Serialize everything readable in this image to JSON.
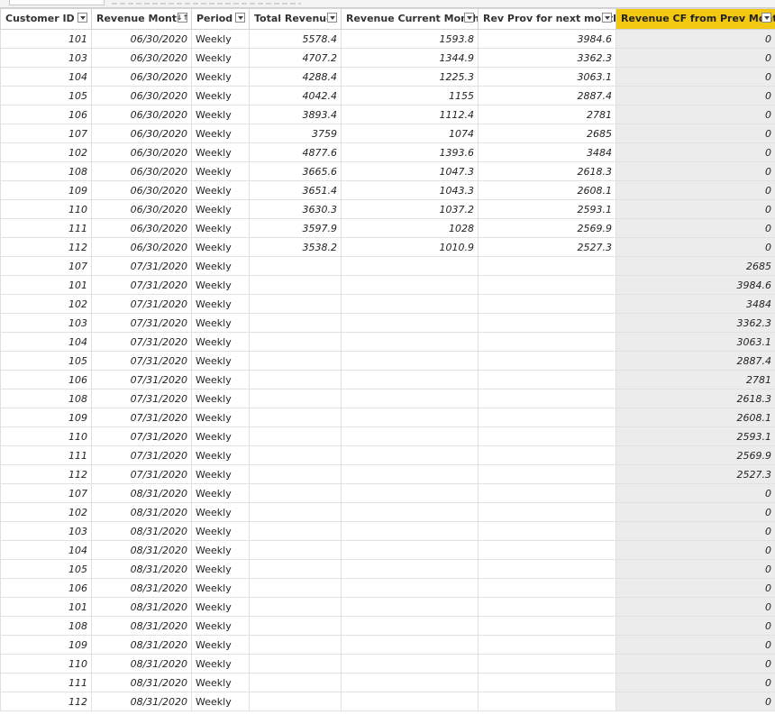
{
  "columns": [
    {
      "label": "Customer ID",
      "filter": "dropdown"
    },
    {
      "label": "Revenue Month",
      "filter": "sorted"
    },
    {
      "label": "Period",
      "filter": "dropdown"
    },
    {
      "label": "Total Revenue",
      "filter": "dropdown"
    },
    {
      "label": "Revenue Current Month",
      "filter": "dropdown"
    },
    {
      "label": "Rev Prov for next month",
      "filter": "dropdown"
    },
    {
      "label": "Revenue CF from Prev Month",
      "filter": "dropdown"
    }
  ],
  "selected_column": 6,
  "colors": {
    "selected_header": "#f2c811",
    "selected_column_fill": "#ececec",
    "grid_line": "#e1e1e1"
  },
  "icons": {
    "filter": "chevron-down-icon",
    "sort": "sort-ascending-icon"
  },
  "sort_glyph": "↓↑",
  "rows": [
    [
      "101",
      "06/30/2020",
      "Weekly",
      "5578.4",
      "1593.8",
      "3984.6",
      "0"
    ],
    [
      "103",
      "06/30/2020",
      "Weekly",
      "4707.2",
      "1344.9",
      "3362.3",
      "0"
    ],
    [
      "104",
      "06/30/2020",
      "Weekly",
      "4288.4",
      "1225.3",
      "3063.1",
      "0"
    ],
    [
      "105",
      "06/30/2020",
      "Weekly",
      "4042.4",
      "1155",
      "2887.4",
      "0"
    ],
    [
      "106",
      "06/30/2020",
      "Weekly",
      "3893.4",
      "1112.4",
      "2781",
      "0"
    ],
    [
      "107",
      "06/30/2020",
      "Weekly",
      "3759",
      "1074",
      "2685",
      "0"
    ],
    [
      "102",
      "06/30/2020",
      "Weekly",
      "4877.6",
      "1393.6",
      "3484",
      "0"
    ],
    [
      "108",
      "06/30/2020",
      "Weekly",
      "3665.6",
      "1047.3",
      "2618.3",
      "0"
    ],
    [
      "109",
      "06/30/2020",
      "Weekly",
      "3651.4",
      "1043.3",
      "2608.1",
      "0"
    ],
    [
      "110",
      "06/30/2020",
      "Weekly",
      "3630.3",
      "1037.2",
      "2593.1",
      "0"
    ],
    [
      "111",
      "06/30/2020",
      "Weekly",
      "3597.9",
      "1028",
      "2569.9",
      "0"
    ],
    [
      "112",
      "06/30/2020",
      "Weekly",
      "3538.2",
      "1010.9",
      "2527.3",
      "0"
    ],
    [
      "107",
      "07/31/2020",
      "Weekly",
      "",
      "",
      "",
      "2685"
    ],
    [
      "101",
      "07/31/2020",
      "Weekly",
      "",
      "",
      "",
      "3984.6"
    ],
    [
      "102",
      "07/31/2020",
      "Weekly",
      "",
      "",
      "",
      "3484"
    ],
    [
      "103",
      "07/31/2020",
      "Weekly",
      "",
      "",
      "",
      "3362.3"
    ],
    [
      "104",
      "07/31/2020",
      "Weekly",
      "",
      "",
      "",
      "3063.1"
    ],
    [
      "105",
      "07/31/2020",
      "Weekly",
      "",
      "",
      "",
      "2887.4"
    ],
    [
      "106",
      "07/31/2020",
      "Weekly",
      "",
      "",
      "",
      "2781"
    ],
    [
      "108",
      "07/31/2020",
      "Weekly",
      "",
      "",
      "",
      "2618.3"
    ],
    [
      "109",
      "07/31/2020",
      "Weekly",
      "",
      "",
      "",
      "2608.1"
    ],
    [
      "110",
      "07/31/2020",
      "Weekly",
      "",
      "",
      "",
      "2593.1"
    ],
    [
      "111",
      "07/31/2020",
      "Weekly",
      "",
      "",
      "",
      "2569.9"
    ],
    [
      "112",
      "07/31/2020",
      "Weekly",
      "",
      "",
      "",
      "2527.3"
    ],
    [
      "107",
      "08/31/2020",
      "Weekly",
      "",
      "",
      "",
      "0"
    ],
    [
      "102",
      "08/31/2020",
      "Weekly",
      "",
      "",
      "",
      "0"
    ],
    [
      "103",
      "08/31/2020",
      "Weekly",
      "",
      "",
      "",
      "0"
    ],
    [
      "104",
      "08/31/2020",
      "Weekly",
      "",
      "",
      "",
      "0"
    ],
    [
      "105",
      "08/31/2020",
      "Weekly",
      "",
      "",
      "",
      "0"
    ],
    [
      "106",
      "08/31/2020",
      "Weekly",
      "",
      "",
      "",
      "0"
    ],
    [
      "101",
      "08/31/2020",
      "Weekly",
      "",
      "",
      "",
      "0"
    ],
    [
      "108",
      "08/31/2020",
      "Weekly",
      "",
      "",
      "",
      "0"
    ],
    [
      "109",
      "08/31/2020",
      "Weekly",
      "",
      "",
      "",
      "0"
    ],
    [
      "110",
      "08/31/2020",
      "Weekly",
      "",
      "",
      "",
      "0"
    ],
    [
      "111",
      "08/31/2020",
      "Weekly",
      "",
      "",
      "",
      "0"
    ],
    [
      "112",
      "08/31/2020",
      "Weekly",
      "",
      "",
      "",
      "0"
    ]
  ]
}
